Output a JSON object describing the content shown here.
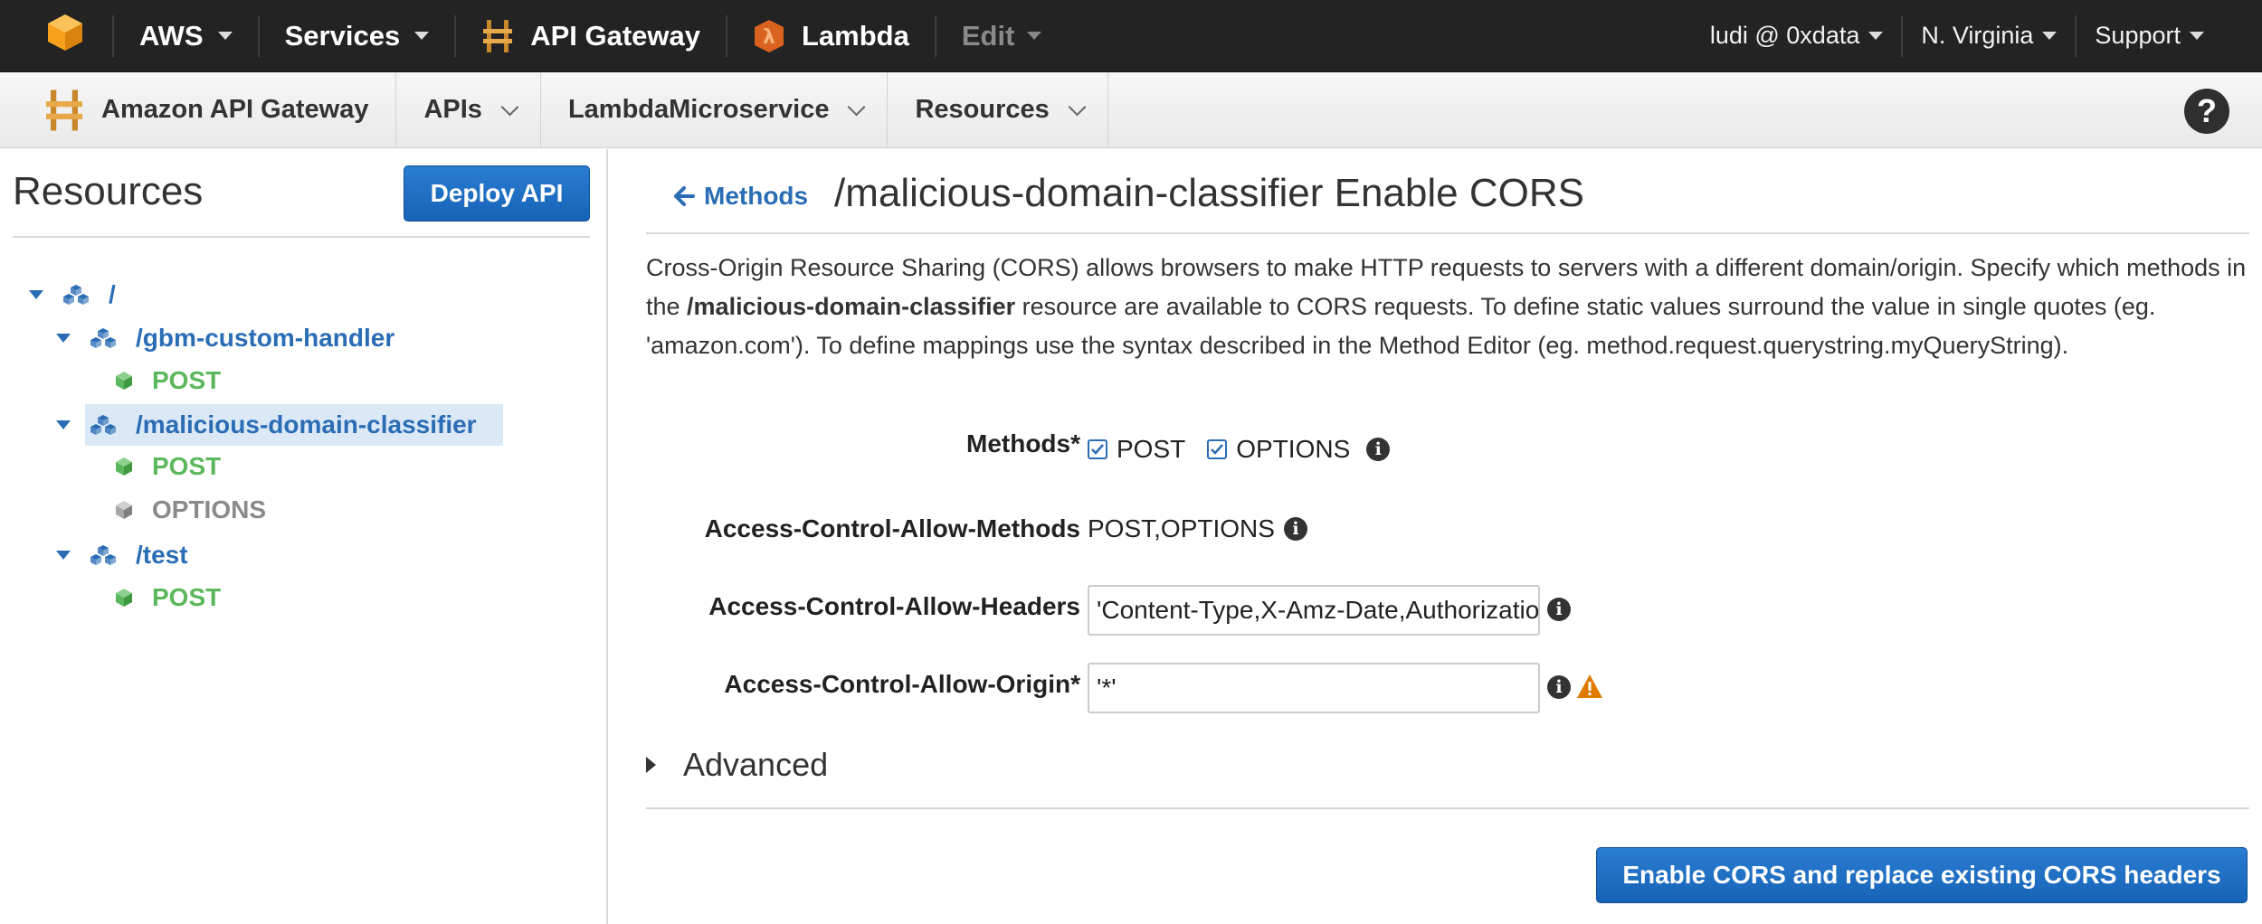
{
  "topbar": {
    "aws": "AWS",
    "services": "Services",
    "api_gateway": "API Gateway",
    "lambda": "Lambda",
    "edit": "Edit",
    "user": "ludi @ 0xdata",
    "region": "N. Virginia",
    "support": "Support"
  },
  "subbar": {
    "brand": "Amazon API Gateway",
    "apis": "APIs",
    "api_name": "LambdaMicroservice",
    "resources": "Resources",
    "help": "?"
  },
  "left": {
    "title": "Resources",
    "deploy": "Deploy API",
    "tree": {
      "root": "/",
      "r1": "/gbm-custom-handler",
      "r1_post": "POST",
      "r2": "/malicious-domain-classifier",
      "r2_post": "POST",
      "r2_options": "OPTIONS",
      "r3": "/test",
      "r3_post": "POST"
    }
  },
  "main": {
    "back": "Methods",
    "title": "/malicious-domain-classifier Enable CORS",
    "desc_1": "Cross-Origin Resource Sharing (CORS) allows browsers to make HTTP requests to servers with a different domain/origin. Specify which methods in the ",
    "desc_bold": "/malicious-domain-classifier",
    "desc_2": " resource are available to CORS requests. To define static values surround the value in single quotes (eg. 'amazon.com'). To define mappings use the syntax described in the Method Editor (eg. method.request.querystring.myQueryString).",
    "methods_label": "Methods*",
    "method_post": "POST",
    "method_options": "OPTIONS",
    "acam_label": "Access-Control-Allow-Methods",
    "acam_value": "POST,OPTIONS",
    "acah_label": "Access-Control-Allow-Headers",
    "acah_value": "'Content-Type,X-Amz-Date,Authorization,X-Api-Key'",
    "acao_label": "Access-Control-Allow-Origin*",
    "acao_value": "'*'",
    "advanced": "Advanced",
    "enable": "Enable CORS and replace existing CORS headers"
  },
  "colors": {
    "link_blue": "#2a6db5",
    "button_blue": "#1f6fc5",
    "method_green": "#5cb85c",
    "warning_orange": "#e07b00",
    "topbar_bg": "#232323"
  }
}
